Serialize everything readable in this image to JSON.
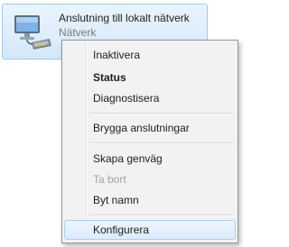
{
  "connection": {
    "title": "Anslutning till lokalt nätverk",
    "subtitle": "Nätverk",
    "icon": "network-adapter-icon"
  },
  "context_menu": {
    "items": [
      {
        "label": "Inaktivera",
        "state": "normal"
      },
      {
        "label": "Status",
        "state": "default-bold"
      },
      {
        "label": "Diagnostisera",
        "state": "normal"
      },
      {
        "label": "Brygga anslutningar",
        "state": "normal"
      },
      {
        "label": "Skapa genväg",
        "state": "normal"
      },
      {
        "label": "Ta bort",
        "state": "disabled"
      },
      {
        "label": "Byt namn",
        "state": "normal"
      },
      {
        "label": "Konfigurera",
        "state": "highlighted"
      }
    ]
  },
  "colors": {
    "selection_border": "#9ec8ee",
    "menu_background": "#f2f2f2",
    "disabled_text": "#a3a3a3"
  }
}
